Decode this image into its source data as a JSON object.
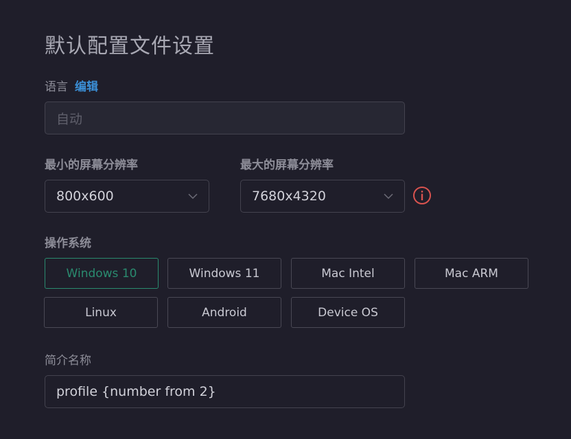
{
  "page": {
    "title": "默认配置文件设置"
  },
  "language": {
    "label": "语言",
    "edit_link": "编辑",
    "value_placeholder": "自动"
  },
  "resolution": {
    "min_label": "最小的屏幕分辨率",
    "min_value": "800x600",
    "max_label": "最大的屏幕分辨率",
    "max_value": "7680x4320"
  },
  "os": {
    "label": "操作系统",
    "options": [
      {
        "label": "Windows 10",
        "selected": true
      },
      {
        "label": "Windows 11",
        "selected": false
      },
      {
        "label": "Mac Intel",
        "selected": false
      },
      {
        "label": "Mac ARM",
        "selected": false
      },
      {
        "label": "Linux",
        "selected": false
      },
      {
        "label": "Android",
        "selected": false
      },
      {
        "label": "Device OS",
        "selected": false
      }
    ]
  },
  "profile_name": {
    "label": "简介名称",
    "value": "profile {number from 2}"
  },
  "colors": {
    "accent_link": "#3b8fd6",
    "selected_green": "#2a8b6f",
    "warning_red": "#d9534f",
    "background": "#1f1e2a"
  },
  "icons": {
    "chevron": "chevron-down-icon",
    "info": "info-circle-icon"
  }
}
